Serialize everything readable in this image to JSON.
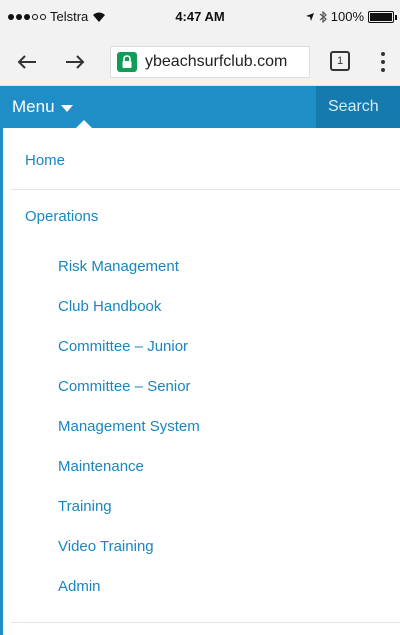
{
  "status_bar": {
    "carrier": "Telstra",
    "time": "4:47 AM",
    "battery": "100%",
    "icons": [
      "signal-dots-icon",
      "wifi-icon",
      "location-arrow-icon",
      "bluetooth-icon",
      "battery-icon"
    ]
  },
  "browser": {
    "url": "ybeachsurfclub.com",
    "tab_count": "1",
    "icons": [
      "back-arrow-icon",
      "forward-arrow-icon",
      "lock-icon",
      "tabs-icon",
      "more-vert-icon"
    ]
  },
  "navbar": {
    "menu_label": "Menu",
    "search_placeholder": "Search",
    "colors": {
      "bar": "#1f8ec6",
      "search": "#157aae",
      "link": "#1a86bf"
    }
  },
  "menu": {
    "home": "Home",
    "operations": "Operations",
    "sub_items": [
      "Risk Management",
      "Club Handbook",
      "Committee – Junior",
      "Committee – Senior",
      "Management System",
      "Maintenance",
      "Training",
      "Video Training",
      "Admin"
    ]
  }
}
